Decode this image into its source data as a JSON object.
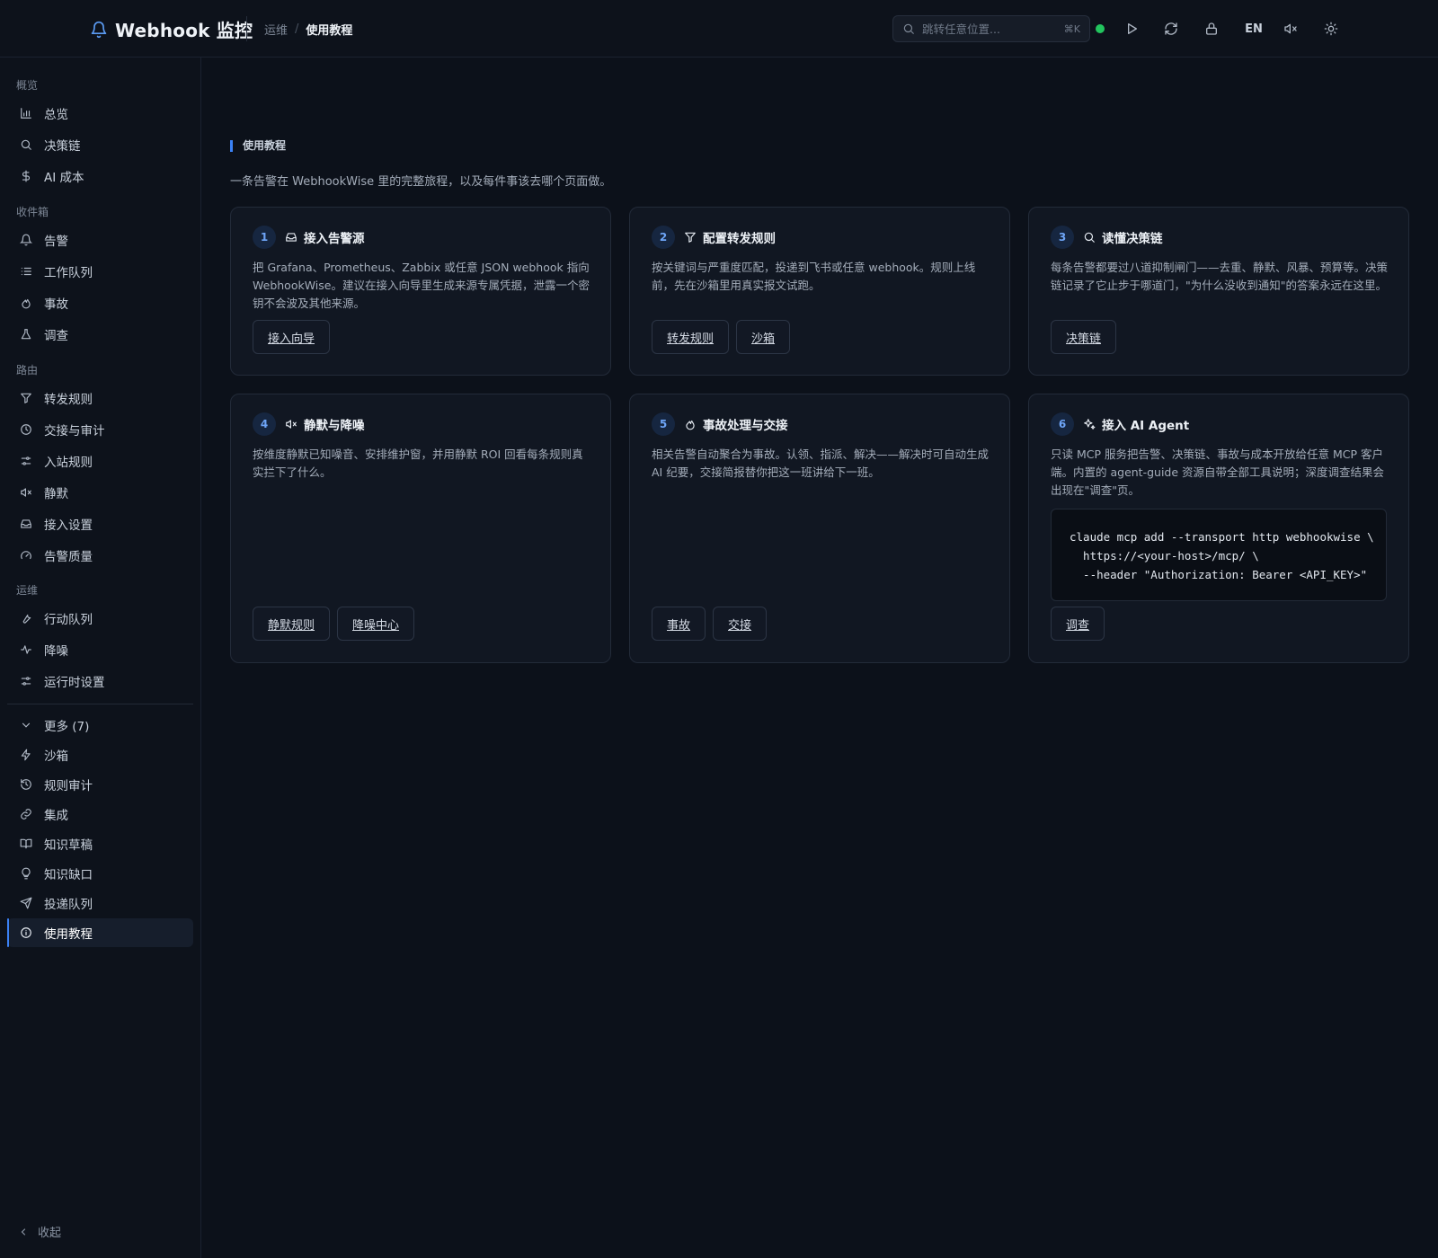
{
  "header": {
    "brand": "Webhook 监控",
    "breadcrumb_parent": "运维",
    "breadcrumb_current": "使用教程",
    "search_placeholder": "跳转任意位置...",
    "search_shortcut": "⌘K",
    "status_color": "#22c55e",
    "lang": "EN",
    "icons": [
      "play-icon",
      "refresh-icon",
      "lock-icon",
      "mute-icon",
      "sun-icon"
    ]
  },
  "sidebar": {
    "sections": [
      {
        "label": "概览",
        "items": [
          "总览",
          "决策链",
          "AI 成本"
        ]
      },
      {
        "label": "收件箱",
        "items": [
          "告警",
          "工作队列",
          "事故",
          "调查"
        ]
      },
      {
        "label": "路由",
        "items": [
          "转发规则",
          "交接与审计",
          "入站规则",
          "静默",
          "接入设置",
          "告警质量"
        ]
      },
      {
        "label": "运维",
        "items": [
          "行动队列",
          "降噪",
          "运行时设置"
        ]
      }
    ],
    "more_label": "更多 (7)",
    "more_items": [
      "沙箱",
      "规则审计",
      "集成",
      "知识草稿",
      "知识缺口",
      "投递队列",
      "使用教程"
    ],
    "active_item": "使用教程",
    "collapse_label": "收起"
  },
  "main": {
    "section_title": "使用教程",
    "lead": "一条告警在 WebhookWise 里的完整旅程，以及每件事该去哪个页面做。",
    "cards": [
      {
        "step": "1",
        "icon": "inbox-icon",
        "title": "接入告警源",
        "desc": "把 Grafana、Prometheus、Zabbix 或任意 JSON webhook 指向 WebhookWise。建议在接入向导里生成来源专属凭据，泄露一个密钥不会波及其他来源。",
        "buttons": [
          "接入向导"
        ]
      },
      {
        "step": "2",
        "icon": "filter-icon",
        "title": "配置转发规则",
        "desc": "按关键词与严重度匹配，投递到飞书或任意 webhook。规则上线前，先在沙箱里用真实报文试跑。",
        "buttons": [
          "转发规则",
          "沙箱"
        ]
      },
      {
        "step": "3",
        "icon": "search-icon",
        "title": "读懂决策链",
        "desc": "每条告警都要过八道抑制闸门——去重、静默、风暴、预算等。决策链记录了它止步于哪道门，\"为什么没收到通知\"的答案永远在这里。",
        "buttons": [
          "决策链"
        ]
      },
      {
        "step": "4",
        "icon": "mute-icon",
        "title": "静默与降噪",
        "desc": "按维度静默已知噪音、安排维护窗，并用静默 ROI 回看每条规则真实拦下了什么。",
        "buttons": [
          "静默规则",
          "降噪中心"
        ]
      },
      {
        "step": "5",
        "icon": "flame-icon",
        "title": "事故处理与交接",
        "desc": "相关告警自动聚合为事故。认领、指派、解决——解决时可自动生成 AI 纪要，交接简报替你把这一班讲给下一班。",
        "buttons": [
          "事故",
          "交接"
        ]
      },
      {
        "step": "6",
        "icon": "sparkles-icon",
        "title": "接入 AI Agent",
        "desc": "只读 MCP 服务把告警、决策链、事故与成本开放给任意 MCP 客户端。内置的 agent-guide 资源自带全部工具说明；深度调查结果会出现在\"调查\"页。",
        "code": "claude mcp add --transport http webhookwise \\\n  https://<your-host>/mcp/ \\\n  --header \"Authorization: Bearer <API_KEY>\"",
        "buttons": [
          "调查"
        ]
      }
    ]
  },
  "colors": {
    "accent": "#3b82f6",
    "background": "#0c111a",
    "card": "#111722"
  }
}
